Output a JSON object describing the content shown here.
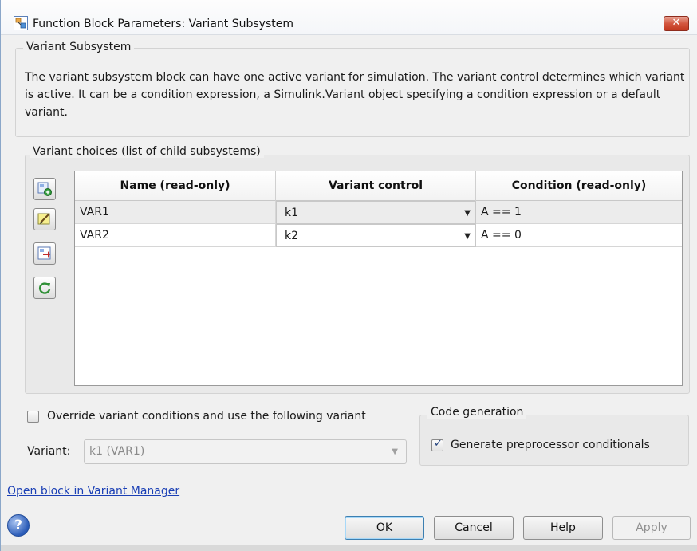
{
  "window": {
    "title": "Function Block Parameters: Variant Subsystem",
    "close_label": "✕"
  },
  "block_group": {
    "legend": "Variant Subsystem",
    "description": "The variant subsystem block can have one active variant for simulation. The variant control determines which variant is active. It can be a condition expression, a Simulink.Variant object specifying a condition expression or a default variant."
  },
  "choices_group": {
    "legend": "Variant choices (list of child subsystems)",
    "toolbar": [
      {
        "icon": "add-choice-icon"
      },
      {
        "icon": "edit-icon"
      },
      {
        "icon": "open-subsystem-icon"
      },
      {
        "icon": "refresh-icon"
      }
    ],
    "table": {
      "headers": [
        "Name (read-only)",
        "Variant control",
        "Condition (read-only)"
      ],
      "rows": [
        {
          "name": "VAR1",
          "control": "k1",
          "condition": "A == 1",
          "selected": true
        },
        {
          "name": "VAR2",
          "control": "k2",
          "condition": "A == 0",
          "selected": false
        }
      ]
    }
  },
  "override": {
    "checkbox_label": "Override variant conditions and use the following variant",
    "checked": false,
    "variant_label": "Variant:",
    "variant_value": "k1 (VAR1)"
  },
  "codegen": {
    "legend": "Code generation",
    "checkbox_label": "Generate preprocessor conditionals",
    "checked": true
  },
  "link_text": "Open block in Variant Manager",
  "buttons": {
    "help_icon": "?",
    "ok": "OK",
    "cancel": "Cancel",
    "help": "Help",
    "apply": "Apply"
  },
  "colors": {
    "close_button": "#d3563f",
    "link": "#1a3fb5",
    "default_button_border": "#3c7fb1"
  }
}
